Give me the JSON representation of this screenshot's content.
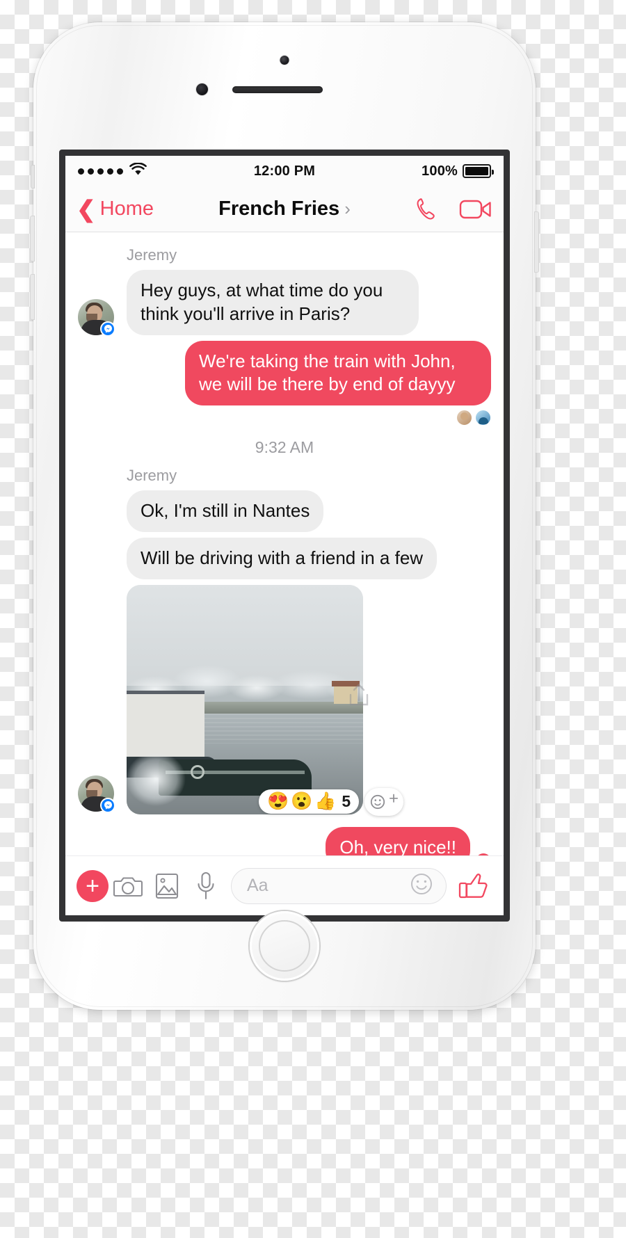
{
  "status_bar": {
    "signal_dots": 5,
    "wifi_icon": "wifi-icon",
    "time": "12:00 PM",
    "battery_percent": "100%",
    "battery_level": 100
  },
  "nav_bar": {
    "back_label": "Home",
    "title": "French Fries",
    "title_chevron": "›",
    "call_icon": "phone-call-icon",
    "video_icon": "video-call-icon",
    "accent_color": "#F2475F"
  },
  "thread": {
    "messages": [
      {
        "type": "incoming-text",
        "sender": "Jeremy",
        "text": "Hey guys, at what time do you think you'll arrive in Paris?",
        "avatar": "jeremy-avatar",
        "badge": "messenger-badge"
      },
      {
        "type": "outgoing-text",
        "text": "We're taking the train with John, we will be there by end of dayyy",
        "receipts": [
          "seen-avatar-1",
          "seen-avatar-2"
        ]
      },
      {
        "type": "timestamp",
        "text": "9:32 AM"
      },
      {
        "type": "incoming-text",
        "sender": "Jeremy",
        "text": "Ok, I'm still in Nantes"
      },
      {
        "type": "incoming-text",
        "text": "Will be driving with a friend in a few"
      },
      {
        "type": "incoming-photo",
        "alt": "winter-river-landscape-photo",
        "upload_icon": "share-upload-icon",
        "reactions": {
          "emojis": [
            "😍",
            "😮",
            "👍"
          ],
          "count": "5",
          "add_label": "add-reaction"
        }
      },
      {
        "type": "outgoing-text",
        "text": "Oh, very nice!!",
        "delivered_icon": "✓"
      }
    ]
  },
  "composer": {
    "plus_label": "+",
    "camera_icon": "camera-icon",
    "gallery_icon": "photo-gallery-icon",
    "mic_icon": "microphone-icon",
    "input_placeholder": "Aa",
    "emoji_icon": "smiley-emoji-icon",
    "thumbs_icon": "thumbs-up-icon"
  }
}
